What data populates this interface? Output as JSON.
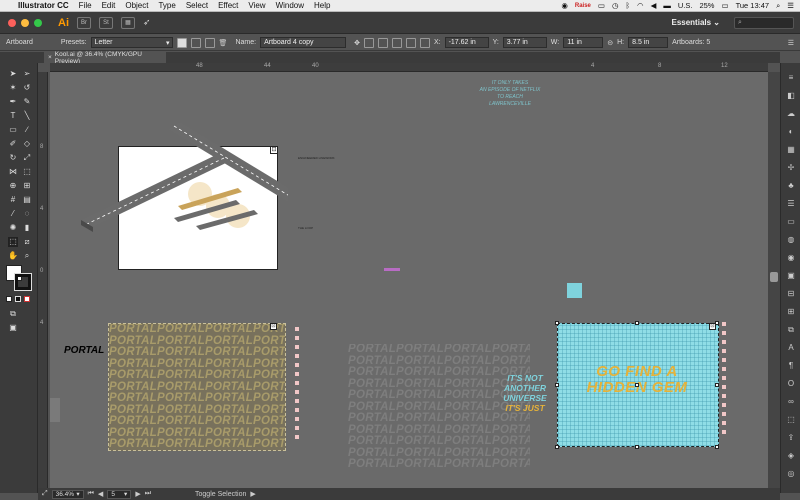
{
  "menubar": {
    "app_name": "Illustrator CC",
    "items": [
      "File",
      "Edit",
      "Object",
      "Type",
      "Select",
      "Effect",
      "View",
      "Window",
      "Help"
    ],
    "status_raise": "Raise",
    "locale": "U.S.",
    "battery": "25%",
    "clock": "Tue 13:47"
  },
  "appbar": {
    "logo": "Ai",
    "btn_br": "Br",
    "btn_st": "St",
    "workspace": "Essentials",
    "workspace_caret": "⌄"
  },
  "control": {
    "mode_label": "Artboard",
    "presets_label": "Presets:",
    "presets_value": "Letter",
    "name_label": "Name:",
    "name_value": "Artboard 4 copy",
    "x_label": "X:",
    "x_value": "-17.62 in",
    "y_label": "Y:",
    "y_value": "3.77 in",
    "w_label": "W:",
    "w_value": "11 in",
    "h_label": "H:",
    "h_value": "8.5 in",
    "artboards_label": "Artboards: 5"
  },
  "doc": {
    "tab_title": "Kool.ai @ 36.4% (CMYK/GPU Preview)"
  },
  "rulers": {
    "h_ticks": [
      "48",
      "44",
      "40",
      "4",
      "8",
      "12"
    ],
    "v_ticks": [
      "8",
      "4",
      "0",
      "4"
    ]
  },
  "status": {
    "zoom": "36.4%",
    "artboard_index": "5",
    "mode": "Toggle Selection"
  },
  "canvas": {
    "tagline_lines": [
      "IT ONLY TAKES",
      "AN EPISODE OF NETFLIX",
      "TO REACH",
      "LAWRENCEVILLE"
    ],
    "tiny_note_1": "ENGINEERED LINEWORK",
    "tiny_note_2": "THE LOOP",
    "portal_label": "PORTAL",
    "portal_word": "PORTAL",
    "universe_lines": [
      "IT'S NOT",
      "ANOTHER",
      "UNIVERSE",
      "IT'S JUST"
    ],
    "gem_lines": [
      "GO FIND A",
      "HIDDEN GEM"
    ]
  },
  "colors": {
    "canvas": "#6a6a6a",
    "teal": "#7fd3dd",
    "gold": "#e5b23a",
    "road": "#6b6b6b"
  }
}
